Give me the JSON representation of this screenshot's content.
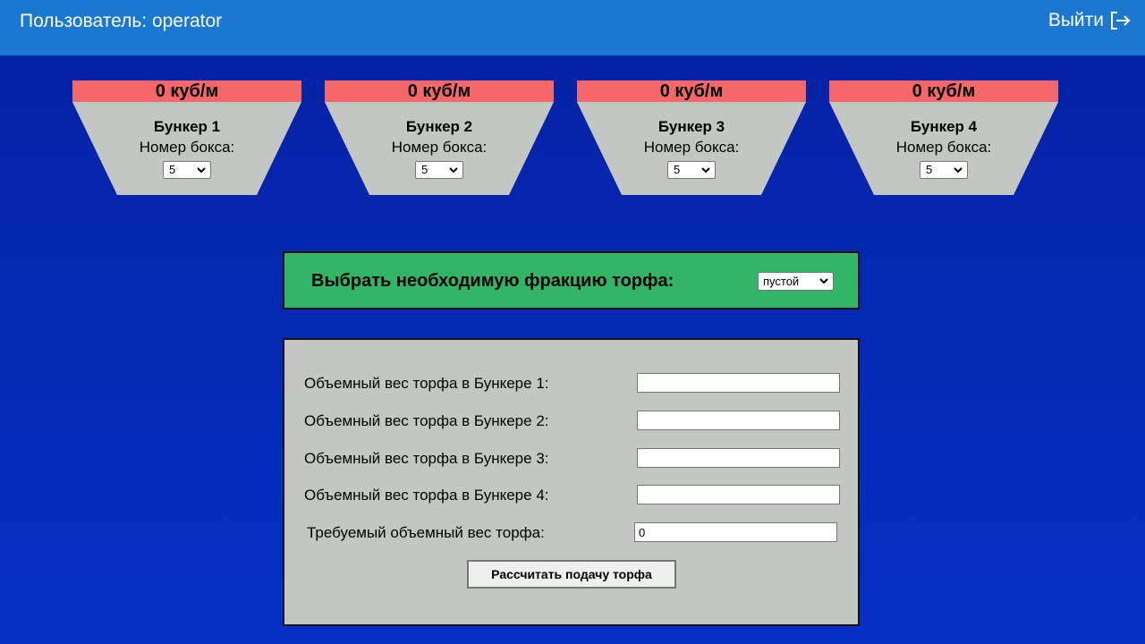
{
  "header": {
    "user_label": "Пользователь: operator",
    "logout_label": "Выйти",
    "logout_icon": "logout-icon"
  },
  "colors": {
    "header_bg": "#1b78d0",
    "page_bg": "#0422a3",
    "volume_bar": "#f6676a",
    "hopper": "#c3c6c3",
    "fraction_panel": "#33b567",
    "calc_panel": "#c3c6c3"
  },
  "bunkers": [
    {
      "volume": "0 куб/м",
      "name": "Бункер 1",
      "box_label": "Номер бокса:",
      "box_value": "5"
    },
    {
      "volume": "0 куб/м",
      "name": "Бункер 2",
      "box_label": "Номер бокса:",
      "box_value": "5"
    },
    {
      "volume": "0 куб/м",
      "name": "Бункер 3",
      "box_label": "Номер бокса:",
      "box_value": "5"
    },
    {
      "volume": "0 куб/м",
      "name": "Бункер 4",
      "box_label": "Номер бокса:",
      "box_value": "5"
    }
  ],
  "fraction": {
    "label": "Выбрать необходимую фракцию торфа:",
    "selected": "пустой"
  },
  "calc": {
    "rows": [
      {
        "label": "Объемный вес торфа в Бункере 1:",
        "value": ""
      },
      {
        "label": "Объемный вес торфа в Бункере 2:",
        "value": ""
      },
      {
        "label": "Объемный вес торфа в Бункере 3:",
        "value": ""
      },
      {
        "label": "Объемный вес торфа в Бункере 4:",
        "value": ""
      }
    ],
    "required_label": "Требуемый объемный вес торфа:",
    "required_value": "0",
    "button_label": "Рассчитать подачу торфа"
  }
}
